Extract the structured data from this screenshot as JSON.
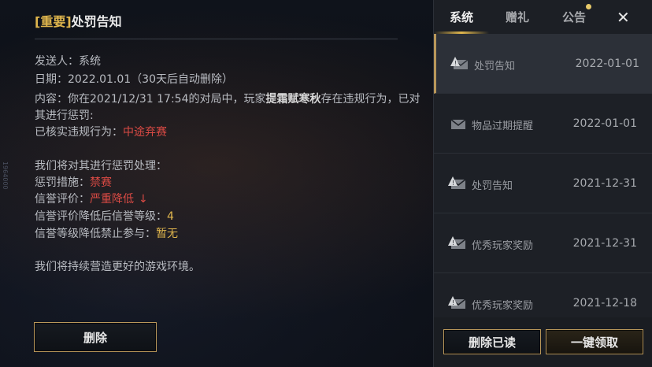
{
  "mail": {
    "tag": "[重要]",
    "title": "处罚告知",
    "sender_label": "发送人：",
    "sender_value": "系统",
    "date_label": "日期：",
    "date_value": "2022.01.01（30天后自动删除）",
    "content_label": "内容：",
    "content_line1_a": "你在2021/12/31 17:54的对局中，玩家",
    "content_player": "提霜赋寒秋",
    "content_line1_b": "存在违规行为，已对",
    "content_line2": "其进行惩罚:",
    "verified_label": "已核实违规行为：",
    "verified_value": "中途弃赛",
    "handle_heading": "我们将对其进行惩罚处理：",
    "punish_label": "惩罚措施：",
    "punish_value": "禁赛",
    "credit_label": "信誉评价：",
    "credit_value": "严重降低",
    "credit_arrow": "↓",
    "level_label": "信誉评价降低后信誉等级：",
    "level_value": "4",
    "ban_label": "信誉等级降低禁止参与：",
    "ban_value": "暂无",
    "closing": "我们将持续营造更好的游戏环境。"
  },
  "buttons": {
    "delete": "删除",
    "delete_read": "删除已读",
    "claim_all": "一键领取"
  },
  "tabs": [
    {
      "label": "系统",
      "active": true
    },
    {
      "label": "赠礼",
      "active": false
    },
    {
      "label": "公告",
      "active": false,
      "has_notification": true
    }
  ],
  "side_label": "1964000",
  "list": [
    {
      "title": "处罚告知",
      "date": "2022-01-01",
      "icon": "mail-warning-icon",
      "active": true
    },
    {
      "title": "物品过期提醒",
      "date": "2022-01-01",
      "icon": "mail-icon",
      "active": false
    },
    {
      "title": "处罚告知",
      "date": "2021-12-31",
      "icon": "mail-warning-icon",
      "active": false
    },
    {
      "title": "优秀玩家奖励",
      "date": "2021-12-31",
      "icon": "mail-warning-icon",
      "active": false
    },
    {
      "title": "优秀玩家奖励",
      "date": "2021-12-18",
      "icon": "mail-warning-icon",
      "active": false
    }
  ],
  "colors": {
    "accent_gold": "#e0b64d",
    "warning_red": "#d94a44",
    "panel_bg": "#1c1f25"
  }
}
